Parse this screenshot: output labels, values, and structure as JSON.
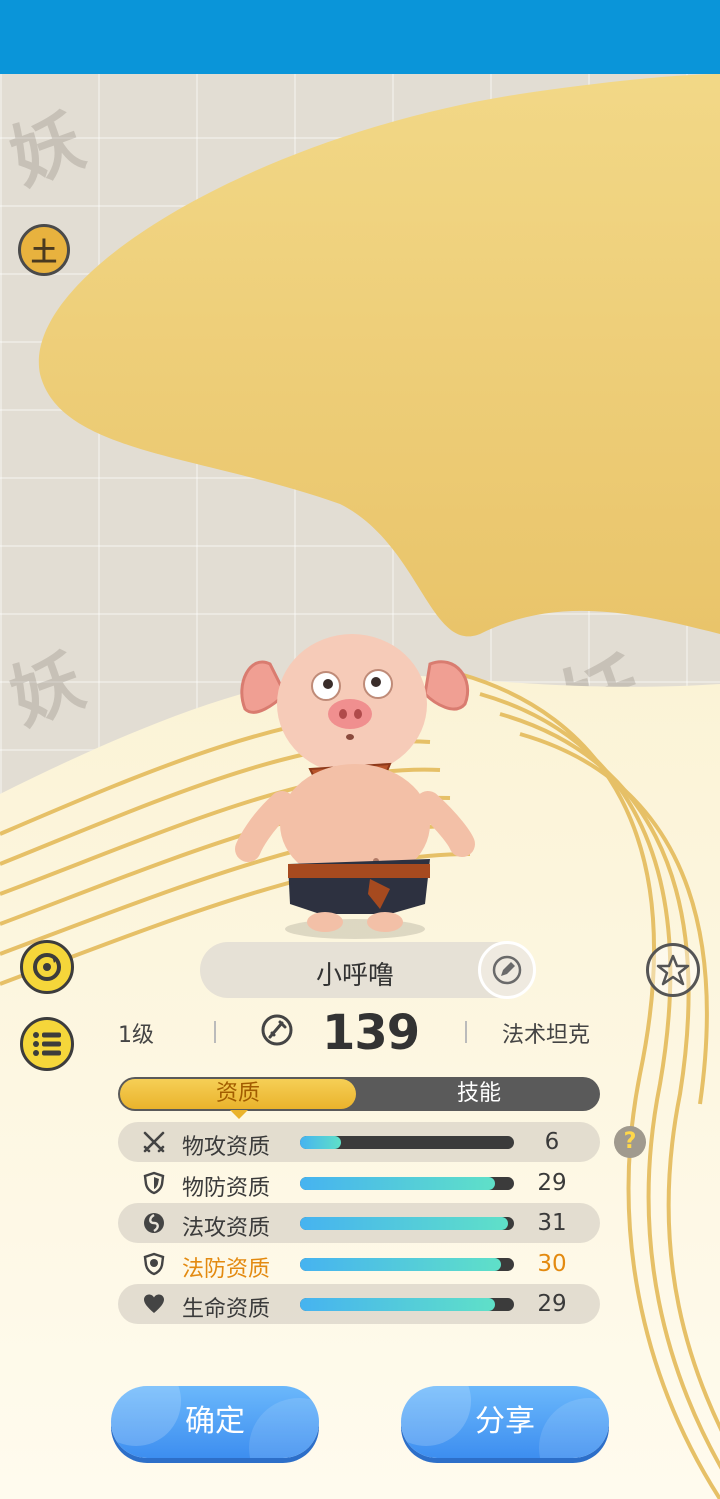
{
  "pet": {
    "name": "小呼噜",
    "level": "1级",
    "power": "139",
    "role": "法术坦克",
    "element_badge": "土"
  },
  "tabs": {
    "active": "资质",
    "inactive": "技能"
  },
  "stats": [
    {
      "label": "物攻资质",
      "value": "6",
      "fill": 0.19,
      "icon": "crossed-swords-icon",
      "highlight": false
    },
    {
      "label": "物防资质",
      "value": "29",
      "fill": 0.91,
      "icon": "shield-icon",
      "highlight": false
    },
    {
      "label": "法攻资质",
      "value": "31",
      "fill": 0.97,
      "icon": "magic-orb-icon",
      "highlight": false
    },
    {
      "label": "法防资质",
      "value": "30",
      "fill": 0.94,
      "icon": "magic-shield-icon",
      "highlight": true
    },
    {
      "label": "生命资质",
      "value": "29",
      "fill": 0.91,
      "icon": "heart-icon",
      "highlight": false
    }
  ],
  "buttons": {
    "confirm": "确定",
    "share": "分享",
    "help": "?"
  },
  "colors": {
    "status_bar": "#0a95d9",
    "accent_gold": "#eab32c",
    "highlight": "#e38a10",
    "button_blue": "#3d8ef0"
  }
}
